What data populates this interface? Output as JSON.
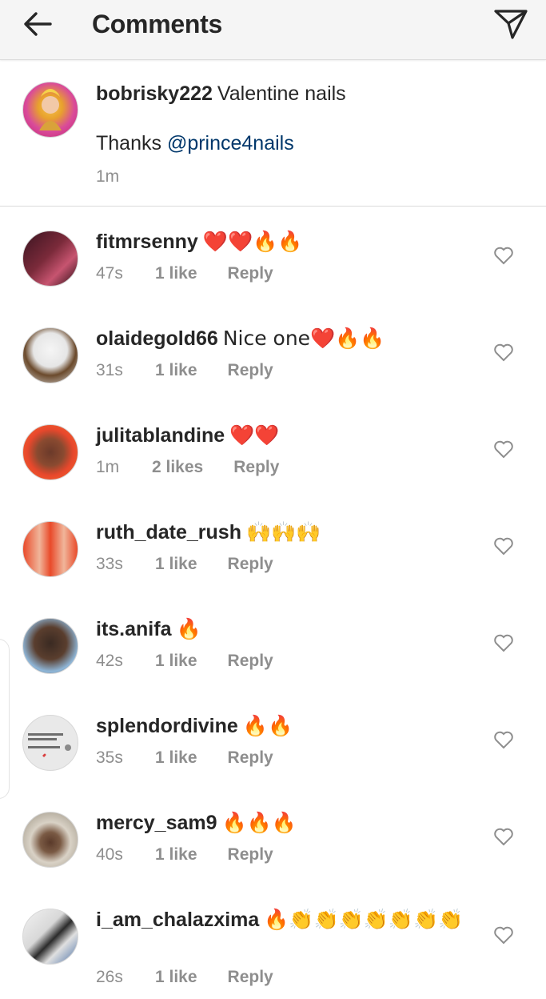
{
  "header": {
    "title": "Comments",
    "back_icon": "arrow-left-icon",
    "send_icon": "paper-plane-icon"
  },
  "caption": {
    "username": "bobrisky222",
    "text": "Valentine nails",
    "thanks_prefix": "Thanks ",
    "mention": "@prince4nails",
    "time": "1m"
  },
  "comments": [
    {
      "username": "fitmrsenny",
      "text": "❤️❤️🔥🔥",
      "time": "47s",
      "likes": "1 like",
      "reply": "Reply"
    },
    {
      "username": "olaidegold66",
      "text": "Nice one❤️🔥🔥",
      "time": "31s",
      "likes": "1 like",
      "reply": "Reply"
    },
    {
      "username": "julitablandine",
      "text": "❤️❤️",
      "time": "1m",
      "likes": "2 likes",
      "reply": "Reply"
    },
    {
      "username": "ruth_date_rush",
      "text": "🙌🙌🙌",
      "time": "33s",
      "likes": "1 like",
      "reply": "Reply"
    },
    {
      "username": "its.anifa",
      "text": "🔥",
      "time": "42s",
      "likes": "1 like",
      "reply": "Reply"
    },
    {
      "username": "splendordivine",
      "text": "🔥🔥",
      "time": "35s",
      "likes": "1 like",
      "reply": "Reply"
    },
    {
      "username": "mercy_sam9",
      "text": "🔥🔥🔥",
      "time": "40s",
      "likes": "1 like",
      "reply": "Reply"
    },
    {
      "username": "i_am_chalazxima",
      "text": "🔥👏👏👏👏👏👏👏",
      "time": "26s",
      "likes": "1 like",
      "reply": "Reply"
    }
  ],
  "colors": {
    "mention": "#00376b",
    "meta_gray": "#8e8e8e",
    "text": "#262626",
    "header_bg": "#f5f5f5"
  }
}
